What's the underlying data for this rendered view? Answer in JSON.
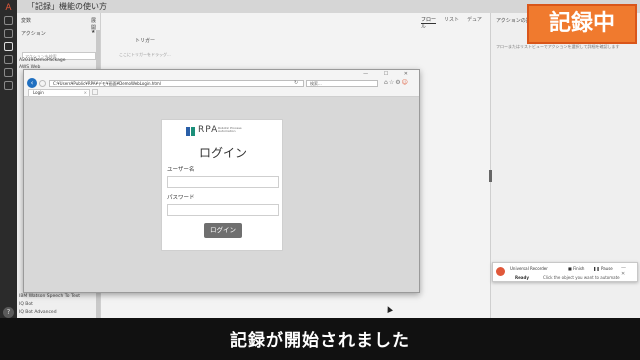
{
  "app": {
    "title": "「記録」機能の使い方"
  },
  "left_panel": {
    "variables_header": "変数",
    "expand_label": "展開",
    "actions_header": "アクション",
    "search_placeholder": "アクションを検索",
    "items": [
      "A2019DemoPackage",
      "AWS Web",
      "IBM Watson Speech To Text",
      "IQ Bot",
      "IQ Bot Advanced"
    ]
  },
  "flow": {
    "tabs": [
      "フロー",
      "リスト",
      "デュアル"
    ],
    "trigger_label": "トリガー",
    "trigger_hint": "ここにトリガーをドラッグ..."
  },
  "right_panel": {
    "header": "アクションの詳細",
    "hint": "フローまたはリストビューでアクションを選択して詳細を確認します"
  },
  "browser": {
    "address": "C:¥Users¥Public¥RPA¥デモ¥画面¥DemoWebLogin.html",
    "search_placeholder": "検索...",
    "tab_title": "Login",
    "window_controls": "— ☐ ✕"
  },
  "login": {
    "logo_text": "RPA",
    "logo_sub": "Robotic Process Automation",
    "title": "ログイン",
    "username_label": "ユーザー名",
    "username_value": "",
    "password_label": "パスワード",
    "password_value": "",
    "submit_label": "ログイン"
  },
  "recording_badge": "記録中",
  "recorder": {
    "title": "Universal Recorder",
    "finish_label": "Finish",
    "pause_label": "Pause",
    "status": "Ready",
    "message": "Click the object you want to automate"
  },
  "caption": "記録が開始されました",
  "colors": {
    "badge_bg": "#f07a2e",
    "accent": "#1f6fc0",
    "brand": "#e0583a"
  }
}
